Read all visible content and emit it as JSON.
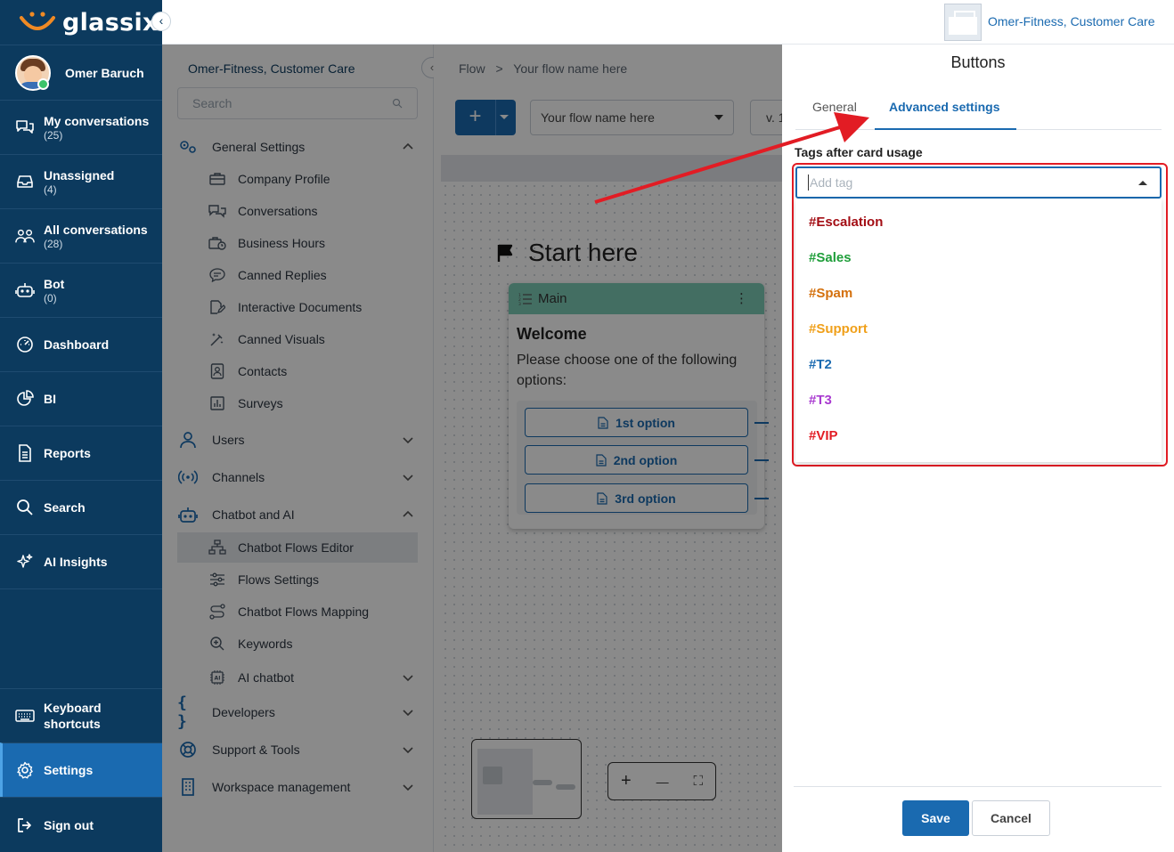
{
  "brand": {
    "name": "glassix"
  },
  "topbar": {
    "workspace_name": "Omer-Fitness, Customer Care"
  },
  "user": {
    "name": "Omer Baruch"
  },
  "nav": [
    {
      "label": "My conversations",
      "count": "(25)"
    },
    {
      "label": "Unassigned",
      "count": "(4)"
    },
    {
      "label": "All conversations",
      "count": "(28)"
    },
    {
      "label": "Bot",
      "count": "(0)"
    },
    {
      "label": "Dashboard"
    },
    {
      "label": "BI"
    },
    {
      "label": "Reports"
    },
    {
      "label": "Search"
    },
    {
      "label": "AI Insights"
    }
  ],
  "nav_bottom": [
    {
      "label": "Keyboard shortcuts"
    },
    {
      "label": "Settings"
    },
    {
      "label": "Sign out"
    }
  ],
  "settings": {
    "title": "Omer-Fitness, Customer Care",
    "search_placeholder": "Search",
    "general_settings": "General Settings",
    "general_items": [
      "Company Profile",
      "Conversations",
      "Business Hours",
      "Canned Replies",
      "Interactive Documents",
      "Canned Visuals",
      "Contacts",
      "Surveys"
    ],
    "users": "Users",
    "channels": "Channels",
    "chatbot_ai": "Chatbot and AI",
    "chatbot_items": [
      "Chatbot Flows Editor",
      "Flows Settings",
      "Chatbot Flows Mapping",
      "Keywords",
      "AI chatbot"
    ],
    "developers": "Developers",
    "support_tools": "Support & Tools",
    "workspace_mgmt": "Workspace management"
  },
  "canvas": {
    "breadcrumb_root": "Flow",
    "breadcrumb_sep": ">",
    "breadcrumb_current": "Your flow name here",
    "add_label": "+",
    "flow_select_value": "Your flow name here",
    "version_label": "v. 1",
    "start_label": "Start here",
    "card": {
      "header": "Main",
      "title": "Welcome",
      "body": "Please choose one of the following options:",
      "options": [
        "1st option",
        "2nd option",
        "3rd option"
      ]
    },
    "zoom_in": "+",
    "zoom_out": "—",
    "fit": "⛶"
  },
  "drawer": {
    "title": "Buttons",
    "tabs": [
      "General",
      "Advanced settings"
    ],
    "tags_label": "Tags after card usage",
    "tag_placeholder": "Add tag",
    "tags": [
      {
        "label": "#Escalation",
        "color": "#a30d14"
      },
      {
        "label": "#Sales",
        "color": "#1f9e3a"
      },
      {
        "label": "#Spam",
        "color": "#d4700c"
      },
      {
        "label": "#Support",
        "color": "#f0a01a"
      },
      {
        "label": "#T2",
        "color": "#1a6ab0"
      },
      {
        "label": "#T3",
        "color": "#a93bd0"
      },
      {
        "label": "#VIP",
        "color": "#e21c24"
      }
    ],
    "save_label": "Save",
    "cancel_label": "Cancel"
  },
  "colors": {
    "nav_bg": "#0c3a5e",
    "accent": "#1a6ab0",
    "annotation": "#e21c24"
  }
}
